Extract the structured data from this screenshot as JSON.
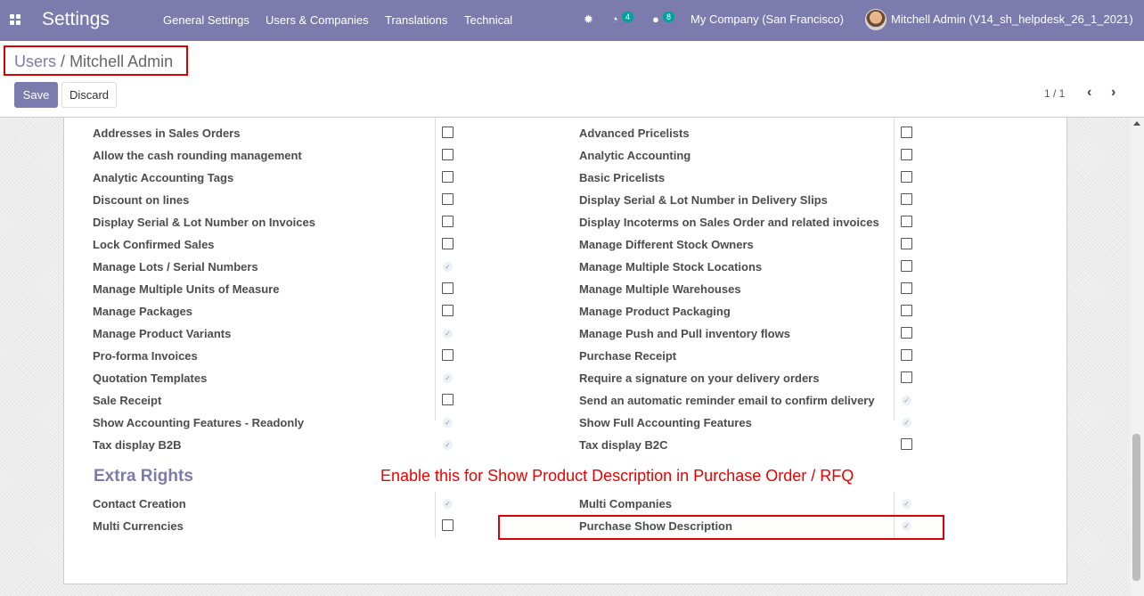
{
  "navbar": {
    "app_title": "Settings",
    "menu": [
      "General Settings",
      "Users & Companies",
      "Translations",
      "Technical"
    ],
    "activity_count": "4",
    "message_count": "8",
    "company": "My Company (San Francisco)",
    "user": "Mitchell Admin (V14_sh_helpdesk_26_1_2021)"
  },
  "breadcrumb": {
    "parent": "Users",
    "separator": "/",
    "current": "Mitchell Admin"
  },
  "actions": {
    "save": "Save",
    "discard": "Discard"
  },
  "pager": {
    "value": "1 / 1"
  },
  "technical_settings": {
    "left": [
      {
        "label": "Addresses in Sales Orders",
        "checked": false
      },
      {
        "label": "Allow the cash rounding management",
        "checked": false
      },
      {
        "label": "Analytic Accounting Tags",
        "checked": false
      },
      {
        "label": "Discount on lines",
        "checked": false
      },
      {
        "label": "Display Serial & Lot Number on Invoices",
        "checked": false
      },
      {
        "label": "Lock Confirmed Sales",
        "checked": false
      },
      {
        "label": "Manage Lots / Serial Numbers",
        "checked": true
      },
      {
        "label": "Manage Multiple Units of Measure",
        "checked": false
      },
      {
        "label": "Manage Packages",
        "checked": false
      },
      {
        "label": "Manage Product Variants",
        "checked": true
      },
      {
        "label": "Pro-forma Invoices",
        "checked": false
      },
      {
        "label": "Quotation Templates",
        "checked": true
      },
      {
        "label": "Sale Receipt",
        "checked": false
      },
      {
        "label": "Show Accounting Features - Readonly",
        "checked": true
      },
      {
        "label": "Tax display B2B",
        "checked": true
      }
    ],
    "right": [
      {
        "label": "Advanced Pricelists",
        "checked": false
      },
      {
        "label": "Analytic Accounting",
        "checked": false
      },
      {
        "label": "Basic Pricelists",
        "checked": false
      },
      {
        "label": "Display Serial & Lot Number in Delivery Slips",
        "checked": false
      },
      {
        "label": "Display Incoterms on Sales Order and related invoices",
        "checked": false
      },
      {
        "label": "Manage Different Stock Owners",
        "checked": false
      },
      {
        "label": "Manage Multiple Stock Locations",
        "checked": false
      },
      {
        "label": "Manage Multiple Warehouses",
        "checked": false
      },
      {
        "label": "Manage Product Packaging",
        "checked": false
      },
      {
        "label": "Manage Push and Pull inventory flows",
        "checked": false
      },
      {
        "label": "Purchase Receipt",
        "checked": false
      },
      {
        "label": "Require a signature on your delivery orders",
        "checked": false
      },
      {
        "label": "Send an automatic reminder email to confirm delivery",
        "checked": true
      },
      {
        "label": "Show Full Accounting Features",
        "checked": true
      },
      {
        "label": "Tax display B2C",
        "checked": false
      }
    ]
  },
  "extra_rights": {
    "title": "Extra Rights",
    "left": [
      {
        "label": "Contact Creation",
        "checked": true
      },
      {
        "label": "Multi Currencies",
        "checked": false
      }
    ],
    "right": [
      {
        "label": "Multi Companies",
        "checked": true
      },
      {
        "label": "Purchase Show Description",
        "checked": true
      }
    ]
  },
  "annotation": "Enable this for Show Product Description in Purchase Order / RFQ",
  "colors": {
    "brand": "#7c7bad",
    "annotation": "#e00000",
    "badge": "#00a09d"
  }
}
